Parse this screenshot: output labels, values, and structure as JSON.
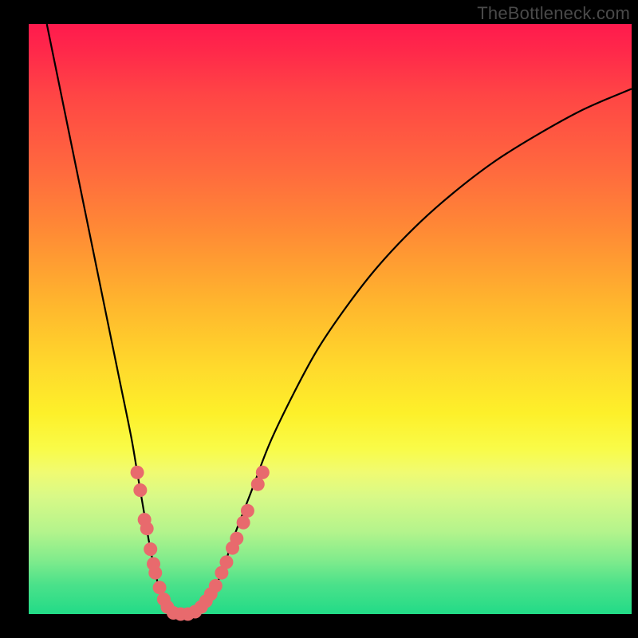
{
  "watermark": "TheBottleneck.com",
  "colors": {
    "curve_stroke": "#000000",
    "dot_fill": "#e86a6d",
    "dot_stroke": "#c94f54"
  },
  "chart_data": {
    "type": "line",
    "title": "",
    "xlabel": "",
    "ylabel": "",
    "xlim": [
      0,
      100
    ],
    "ylim": [
      0,
      100
    ],
    "grid": false,
    "legend": false,
    "series": [
      {
        "name": "bottleneck-curve",
        "x": [
          3,
          5,
          7,
          9,
          11,
          13,
          15,
          17,
          18,
          19,
          20,
          21,
          22,
          23,
          24,
          25,
          27,
          28.5,
          30,
          32,
          34,
          37,
          40,
          44,
          48,
          53,
          58,
          64,
          70,
          77,
          84,
          92,
          100
        ],
        "y": [
          100,
          90,
          80,
          70,
          60,
          50,
          40,
          30,
          24,
          18,
          12,
          7,
          3,
          1,
          0,
          0,
          0,
          1,
          3,
          7,
          13,
          21,
          29,
          37.5,
          45,
          52.5,
          59,
          65.5,
          71,
          76.5,
          81,
          85.5,
          89
        ]
      }
    ],
    "dots": [
      {
        "x": 18.0,
        "y": 24
      },
      {
        "x": 18.5,
        "y": 21
      },
      {
        "x": 19.2,
        "y": 16
      },
      {
        "x": 19.6,
        "y": 14.5
      },
      {
        "x": 20.2,
        "y": 11
      },
      {
        "x": 20.7,
        "y": 8.5
      },
      {
        "x": 21.0,
        "y": 7
      },
      {
        "x": 21.7,
        "y": 4.5
      },
      {
        "x": 22.4,
        "y": 2.5
      },
      {
        "x": 23.0,
        "y": 1.2
      },
      {
        "x": 24.0,
        "y": 0.2
      },
      {
        "x": 25.2,
        "y": 0.0
      },
      {
        "x": 26.4,
        "y": 0.0
      },
      {
        "x": 27.6,
        "y": 0.4
      },
      {
        "x": 28.6,
        "y": 1.2
      },
      {
        "x": 29.4,
        "y": 2.2
      },
      {
        "x": 30.2,
        "y": 3.4
      },
      {
        "x": 31.0,
        "y": 4.8
      },
      {
        "x": 32.0,
        "y": 7.0
      },
      {
        "x": 32.8,
        "y": 8.8
      },
      {
        "x": 33.8,
        "y": 11.2
      },
      {
        "x": 34.5,
        "y": 12.8
      },
      {
        "x": 35.6,
        "y": 15.5
      },
      {
        "x": 36.3,
        "y": 17.5
      },
      {
        "x": 38.0,
        "y": 22.0
      },
      {
        "x": 38.8,
        "y": 24.0
      }
    ]
  }
}
